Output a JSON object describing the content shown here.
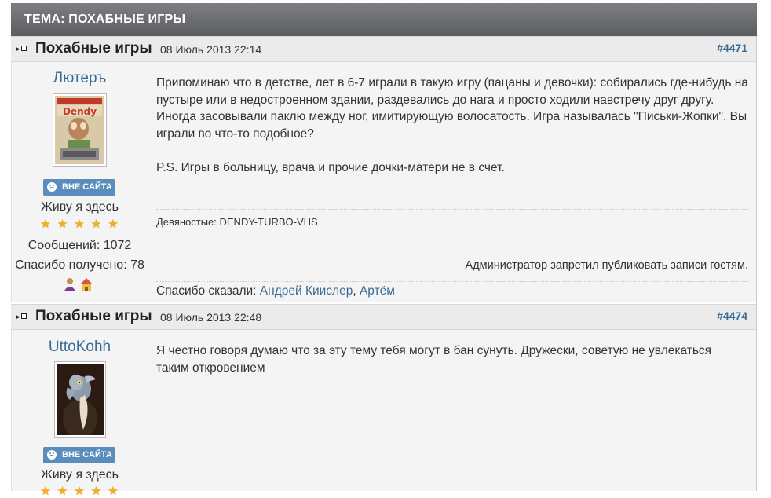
{
  "topic": {
    "title": "ТЕМА: ПОХАБНЫЕ ИГРЫ"
  },
  "posts": [
    {
      "title": "Похабные игры",
      "date": "08 Июль 2013 22:14",
      "number": "#4471",
      "author": {
        "name": "Лютеръ",
        "status": "ВНЕ САЙТА",
        "rank": "Живу я здесь",
        "stars": 5,
        "messages": "Сообщений: 1072",
        "thanks_received": "Спасибо получено: 78",
        "avatar_text": "Dendy"
      },
      "body": [
        "Припоминаю что в детстве, лет в 6-7 играли в такую игру (пацаны и девочки): собирались где-нибудь на пустыре или в недостроенном здании, раздевались до нага и просто ходили навстречу друг другу. Иногда засовывали паклю между ног, имитирующую волосатость. Игра называлась \"Письки-Жопки\". Вы играли во что-то подобное?",
        "P.S. Игры в больницу, врача и прочие дочки-матери не в счет."
      ],
      "signature": "Девяностые: DENDY-TURBO-VHS",
      "admin_note": "Администратор запретил публиковать записи гостям.",
      "thanks_label": "Спасибо сказали:",
      "thanks_users": [
        "Андрей Киислер",
        "Артём"
      ]
    },
    {
      "title": "Похабные игры",
      "date": "08 Июль 2013 22:48",
      "number": "#4474",
      "author": {
        "name": "UttoKohh",
        "status": "ВНЕ САЙТА",
        "rank": "Живу я здесь",
        "stars": 5
      },
      "body": [
        "Я честно говоря думаю что за эту тему тебя могут в бан сунуть. Дружески, советую не увлекаться таким откровением"
      ]
    }
  ],
  "colors": {
    "header": "#6b6d70",
    "link": "#3a6b94",
    "badge": "#5a8dbb",
    "star": "#f2b01e"
  },
  "icons": {
    "post_icon": "arrow-box-icon",
    "status_icon": "smiley-icon",
    "user_icon": "user-icon",
    "home_icon": "home-icon",
    "star_icon": "star-icon"
  }
}
